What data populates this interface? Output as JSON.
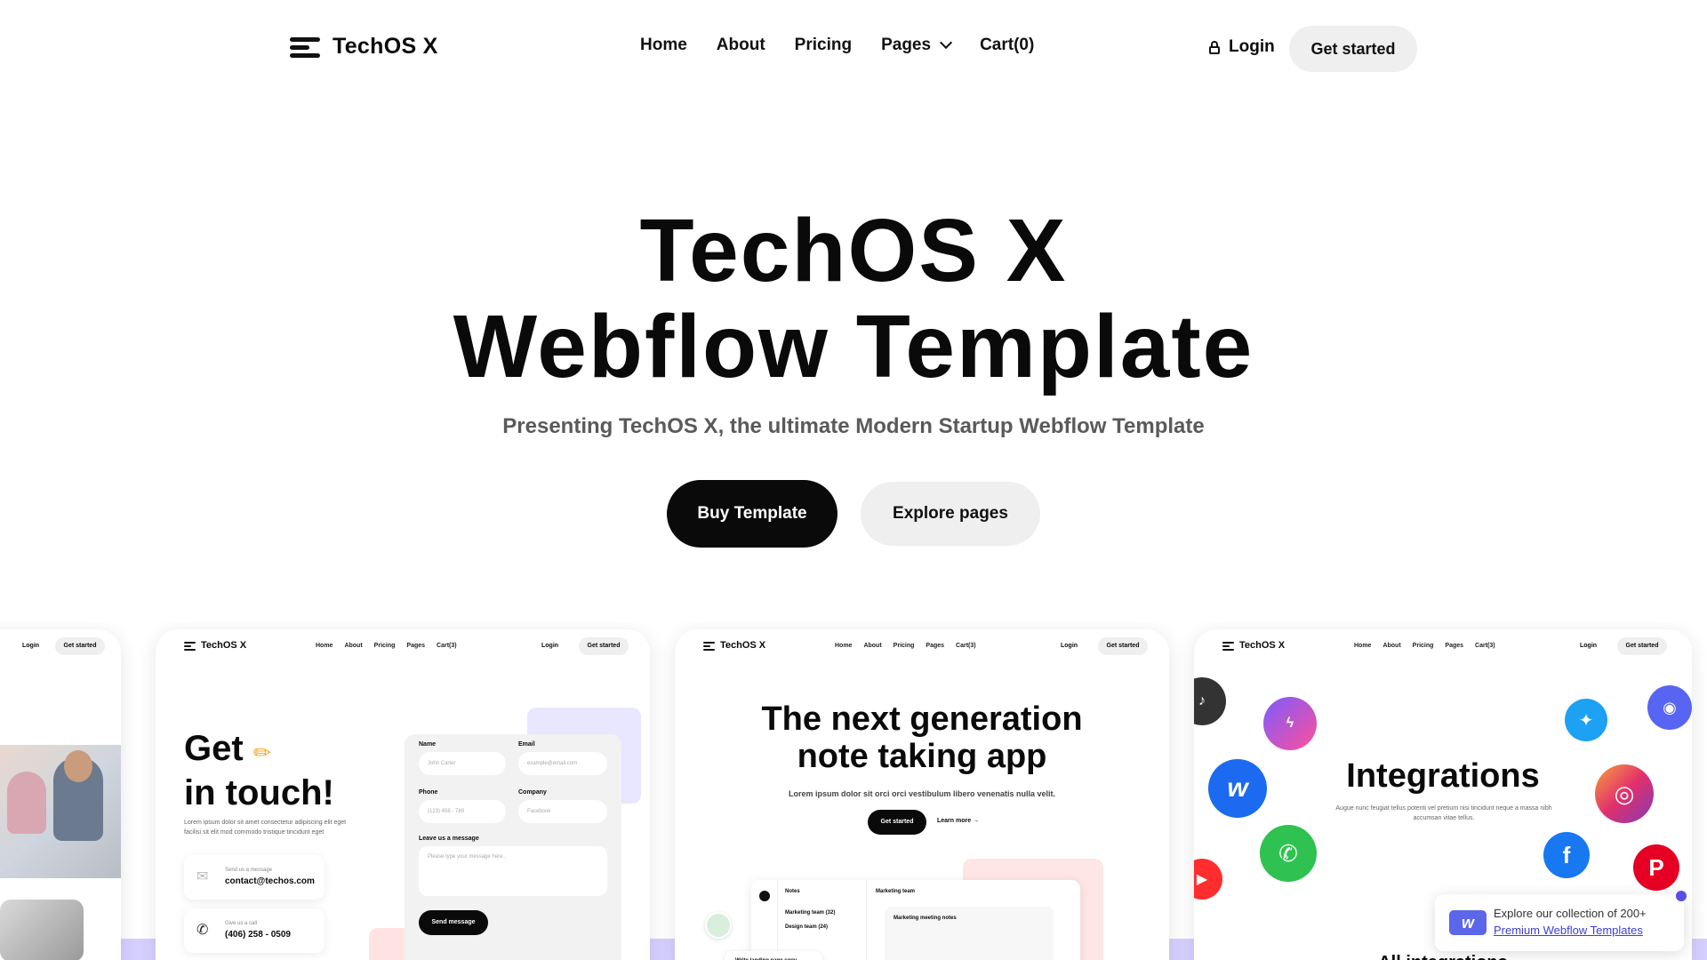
{
  "nav": {
    "brand": "TechOS X",
    "links": [
      "Home",
      "About",
      "Pricing",
      "Pages",
      "Cart(0)"
    ],
    "login": "Login",
    "cta": "Get started"
  },
  "hero": {
    "title_line1": "TechOS X",
    "title_line2": "Webflow Template",
    "subtitle": "Presenting TechOS X, the ultimate Modern Startup Webflow Template",
    "primary_button": "Buy Template",
    "secondary_button": "Explore pages"
  },
  "previews": {
    "mini_nav": {
      "brand": "TechOS X",
      "links": [
        "Home",
        "About",
        "Pricing",
        "Pages",
        "Cart(3)"
      ],
      "login": "Login",
      "cta": "Get started"
    },
    "contact": {
      "title_line1": "Get",
      "title_line2": "in touch!",
      "paragraph": "Lorem ipsum dolor sit amet consectetur adipiscing elit eget facilisi sit elit mod commodo tristique tincidunt eget",
      "email_label": "Send us a message",
      "email": "contact@techos.com",
      "phone_label": "Give us a call",
      "phone": "(406) 258 - 0509",
      "form": {
        "name_label": "Name",
        "name_placeholder": "John Carter",
        "email_label": "Email",
        "email_placeholder": "example@email.com",
        "phone_label": "Phone",
        "phone_placeholder": "(123) 456 - 789",
        "company_label": "Company",
        "company_placeholder": "Facebook",
        "message_label": "Leave us a message",
        "message_placeholder": "Please type your message here...",
        "send": "Send message"
      }
    },
    "notes": {
      "title_line1": "The next generation",
      "title_line2": "note taking app",
      "subtitle": "Lorem ipsum dolor sit orci orci vestibulum libero venenatis nulla velit.",
      "cta": "Get started",
      "learn": "Learn more →",
      "app_notes": "Notes",
      "app_team": "Marketing team (32)",
      "app_team2": "Design team (24)",
      "app_header": "Marketing team",
      "panel_title": "Marketing meeting notes",
      "chip": "Write landing page copy"
    },
    "integrations": {
      "title": "Integrations",
      "subtitle": "Augue nunc feugiat tellus potenti vel pretium nisi tincidunt neque a massa nibh accumsan vitae tellus.",
      "bottom": "All integrations"
    }
  },
  "toast": {
    "line1": "Explore our collection of 200+",
    "line2": "Premium Webflow Templates"
  },
  "colors": {
    "accent_dark": "#0a0a0a",
    "pill_gray": "#efefef",
    "lavender": "#d6d0ff",
    "link_blue": "#3d3ed8"
  }
}
